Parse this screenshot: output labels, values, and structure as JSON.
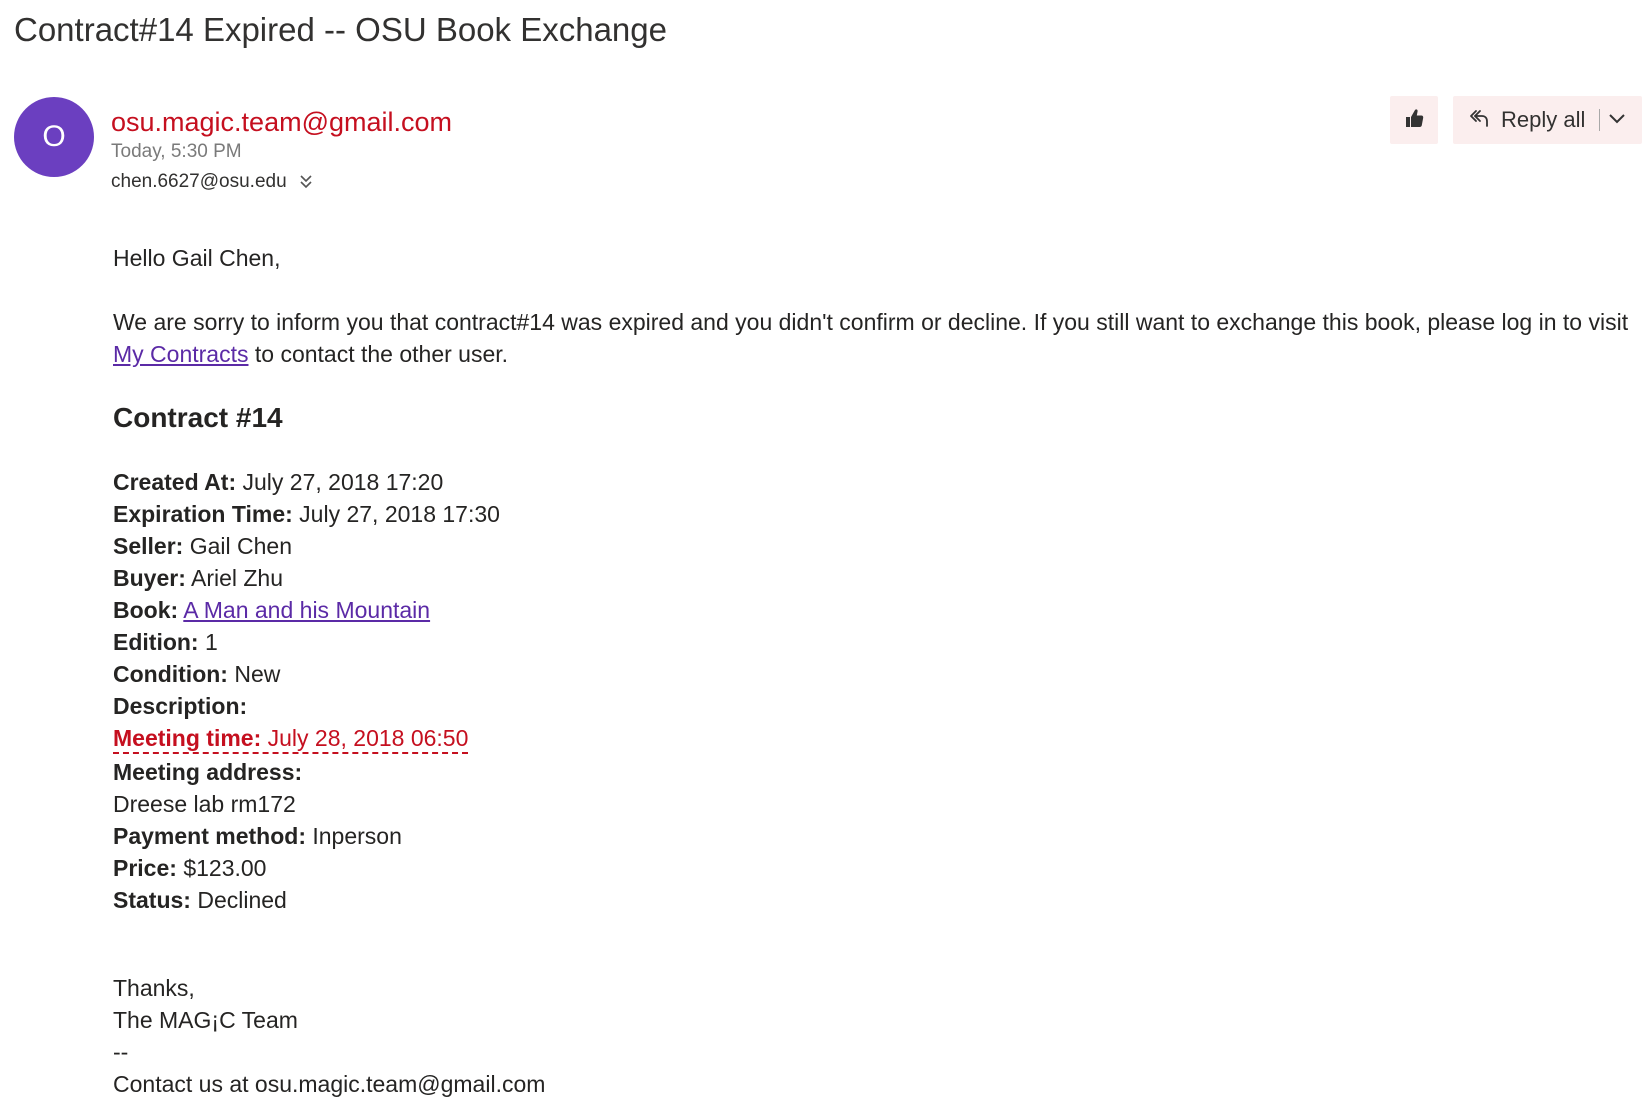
{
  "email": {
    "subject": "Contract#14 Expired -- OSU Book Exchange",
    "avatar_initial": "O",
    "avatar_color": "#6b3fc0",
    "sender": "osu.magic.team@gmail.com",
    "timestamp": "Today, 5:30 PM",
    "recipients": "chen.6627@osu.edu",
    "actions": {
      "like_icon": "thumbs-up-icon",
      "reply_all_icon": "reply-all-icon",
      "reply_all_label": "Reply all",
      "dropdown_icon": "chevron-down-icon"
    }
  },
  "body": {
    "greeting": "Hello Gail Chen,",
    "intro_before_link": "We are sorry to inform you that contract#14 was expired and you didn't confirm or decline. If you still want to exchange this book, please log in to visit ",
    "intro_link": "My Contracts",
    "intro_after_link": " to contact the other user.",
    "contract_title": "Contract #14",
    "fields": {
      "created_at_label": "Created At:",
      "created_at_value": "July 27, 2018 17:20",
      "expiration_label": "Expiration Time:",
      "expiration_value": "July 27, 2018 17:30",
      "seller_label": "Seller:",
      "seller_value": "Gail Chen",
      "buyer_label": "Buyer:",
      "buyer_value": "Ariel Zhu",
      "book_label": "Book:",
      "book_value": "A Man and his Mountain",
      "edition_label": "Edition:",
      "edition_value": "1",
      "condition_label": "Condition:",
      "condition_value": "New",
      "description_label": "Description:",
      "meeting_time_label": "Meeting time:",
      "meeting_time_value": "July 28, 2018 06:50",
      "meeting_address_label": "Meeting address:",
      "meeting_address_value": "Dreese lab rm172",
      "payment_label": "Payment method:",
      "payment_value": "Inperson",
      "price_label": "Price:",
      "price_value": "$123.00",
      "status_label": "Status:",
      "status_value": "Declined"
    },
    "signoff": "Thanks,",
    "team": "The MAG¡C Team",
    "separator": "--",
    "contact": "Contact us at osu.magic.team@gmail.com"
  },
  "colors": {
    "sender": "#c50f1f",
    "link": "#5b2aa6",
    "highlight": "#c50f1f",
    "action_bg": "#fbeeee"
  }
}
